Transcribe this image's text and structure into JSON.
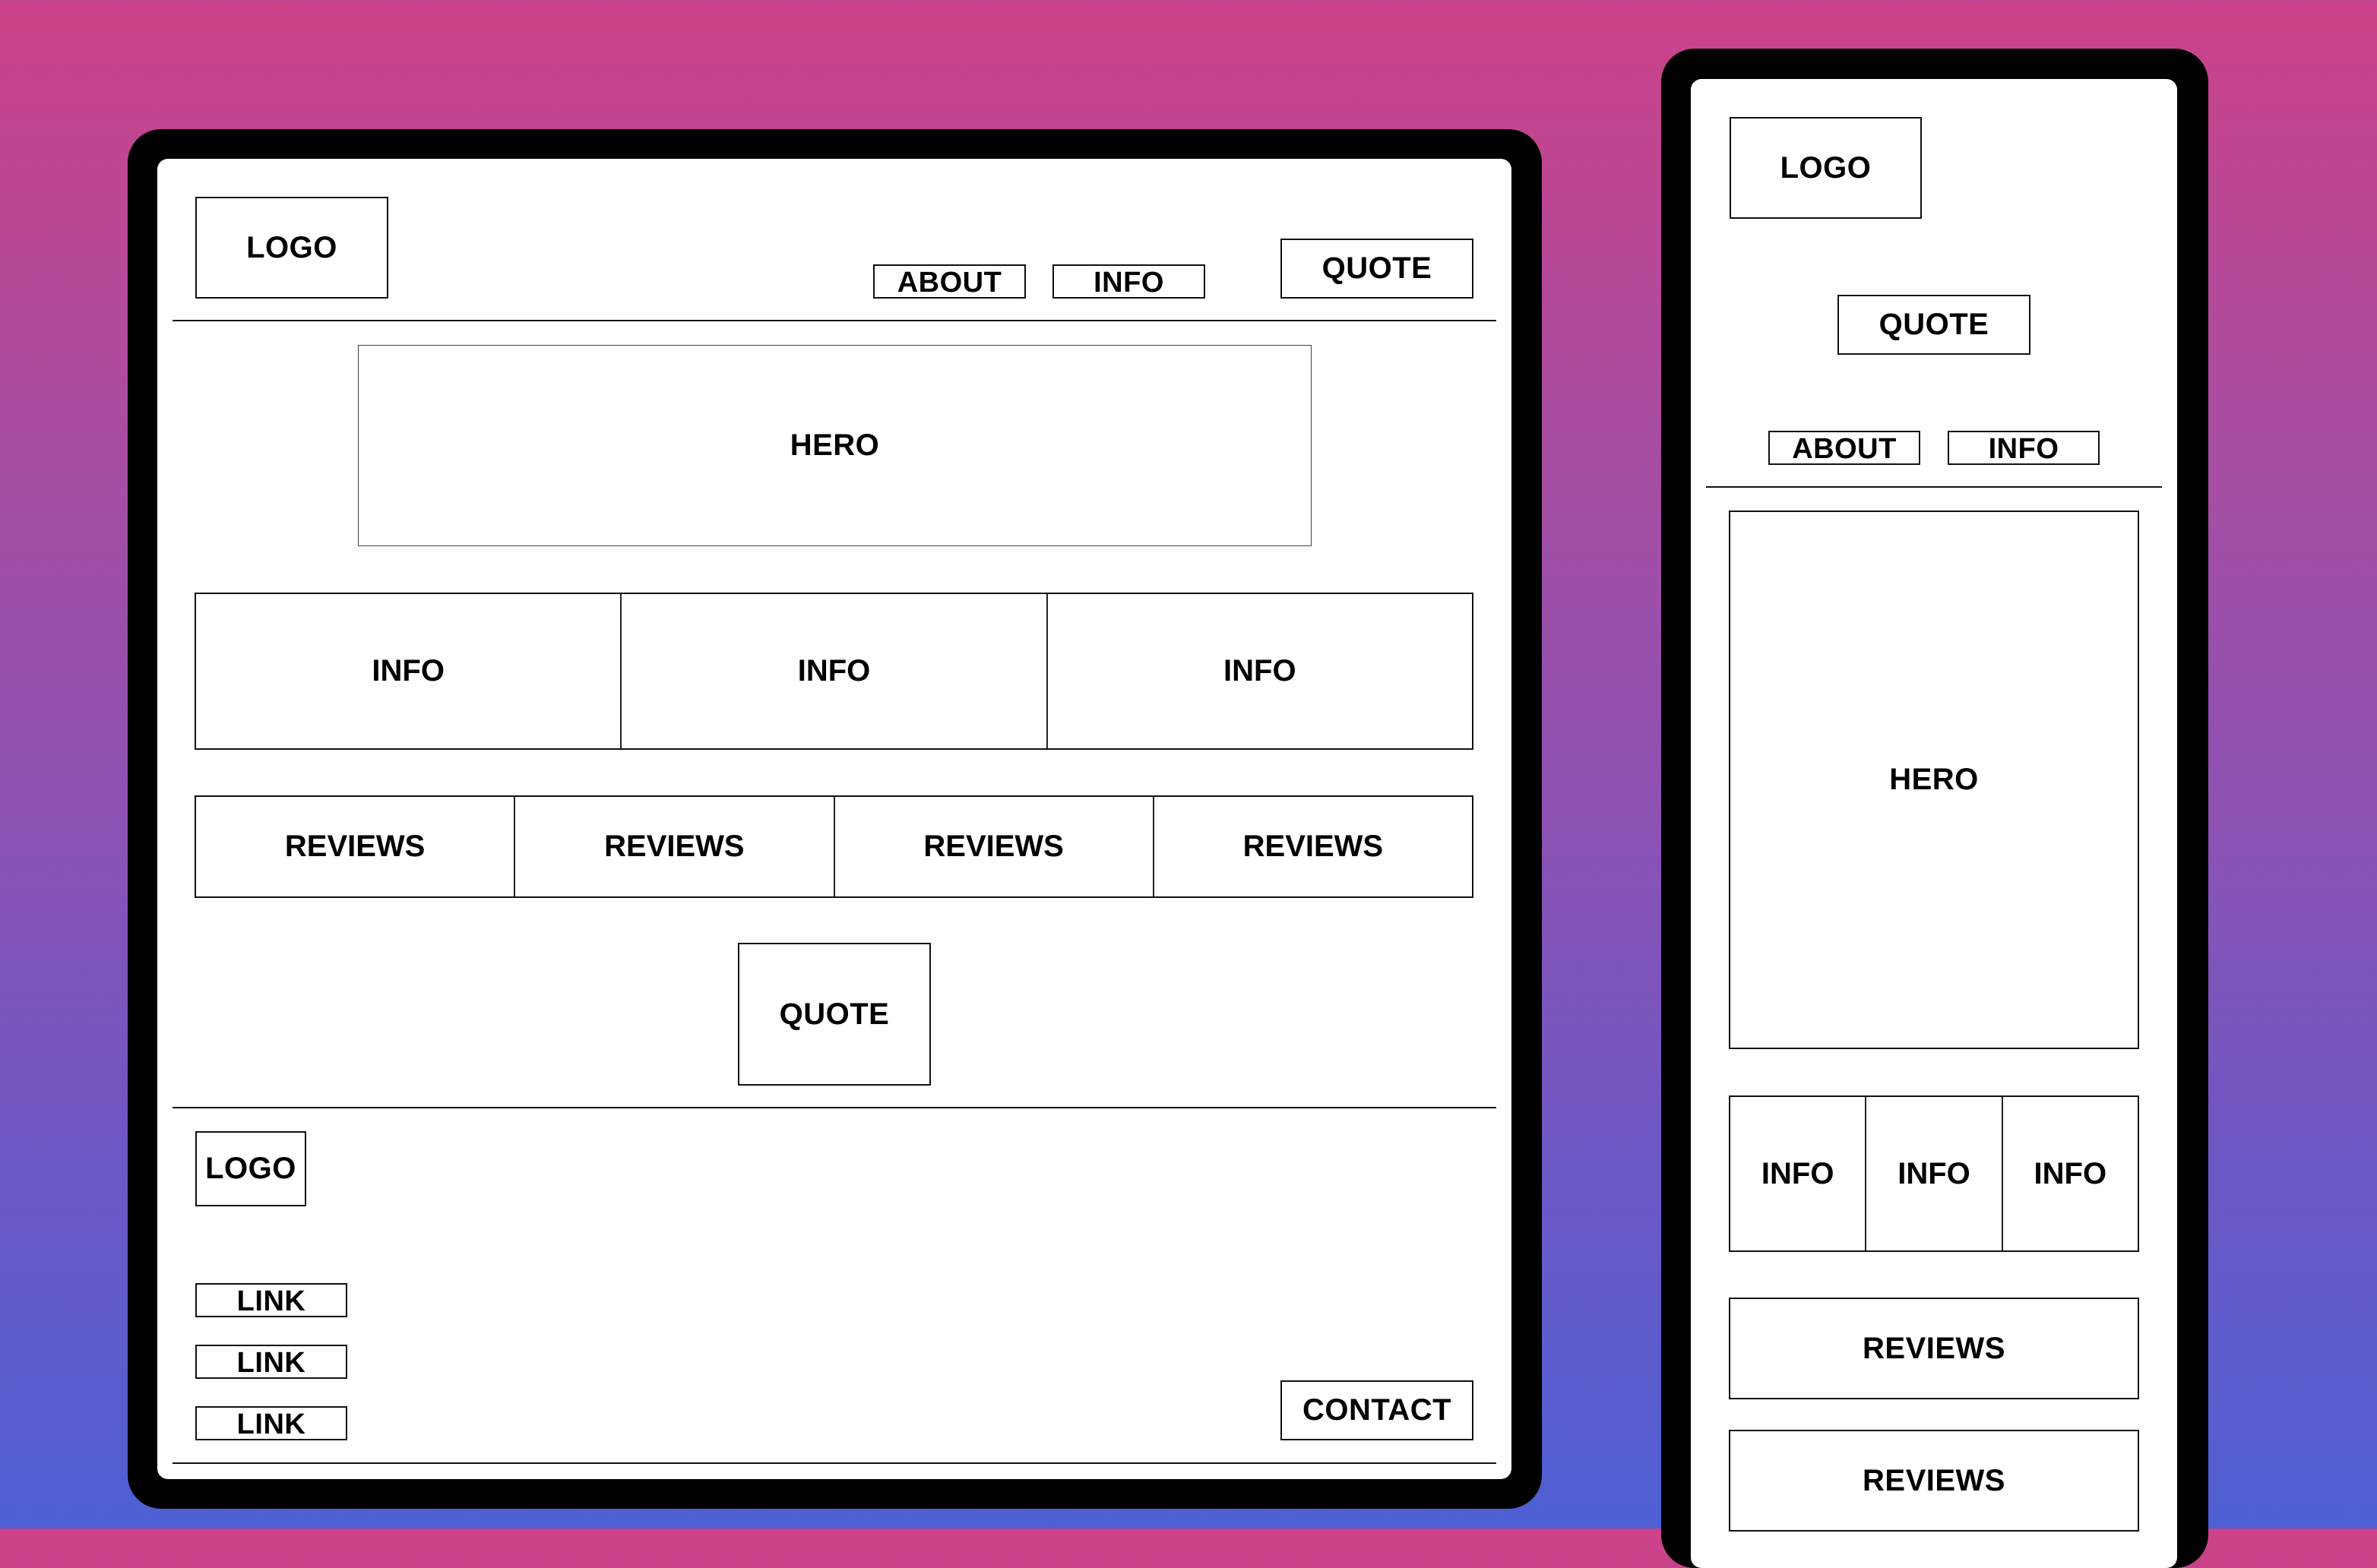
{
  "background": {
    "gradient_top": "#CC4289",
    "gradient_bottom": "#4E60D4"
  },
  "desktop": {
    "header": {
      "logo": "LOGO",
      "nav": [
        "ABOUT",
        "INFO"
      ],
      "cta": "QUOTE"
    },
    "hero": "HERO",
    "info_cards": [
      "INFO",
      "INFO",
      "INFO"
    ],
    "reviews": [
      "REVIEWS",
      "REVIEWS",
      "REVIEWS",
      "REVIEWS"
    ],
    "quote": "QUOTE",
    "footer": {
      "logo": "LOGO",
      "links": [
        "LINK",
        "LINK",
        "LINK"
      ],
      "contact": "CONTACT"
    }
  },
  "mobile": {
    "header": {
      "logo": "LOGO",
      "cta": "QUOTE",
      "nav": [
        "ABOUT",
        "INFO"
      ]
    },
    "hero": "HERO",
    "info_cards": [
      "INFO",
      "INFO",
      "INFO"
    ],
    "reviews": [
      "REVIEWS",
      "REVIEWS"
    ]
  }
}
